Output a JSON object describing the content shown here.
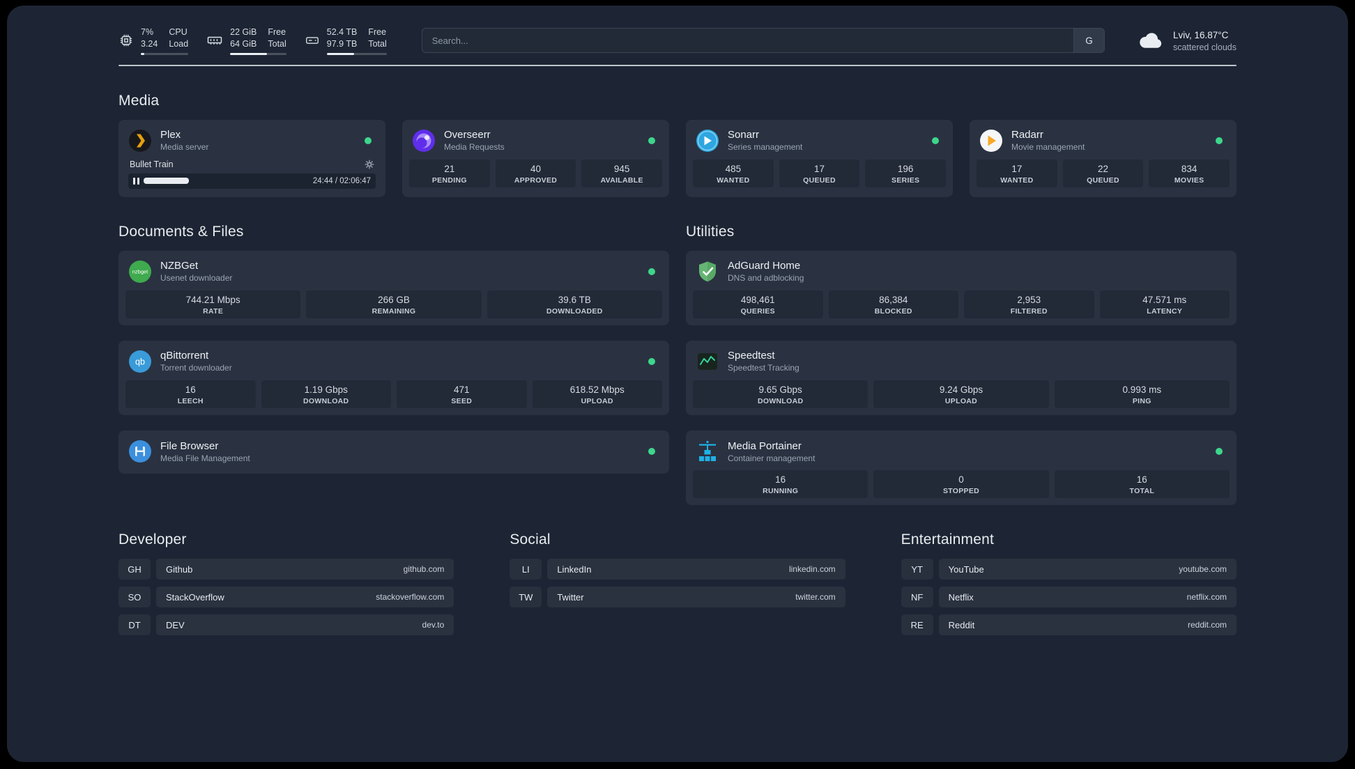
{
  "topbar": {
    "cpu": {
      "percent": "7%",
      "load": "3.24",
      "label1": "CPU",
      "label2": "Load",
      "progress_pct": 7
    },
    "memory": {
      "free": "22 GiB",
      "total": "64 GiB",
      "label1": "Free",
      "label2": "Total",
      "progress_pct": 66
    },
    "disk": {
      "free": "52.4 TB",
      "total": "97.9 TB",
      "label1": "Free",
      "label2": "Total",
      "progress_pct": 46
    },
    "search": {
      "placeholder": "Search...",
      "provider": "G"
    },
    "weather": {
      "location": "Lviv, 16.87°C",
      "condition": "scattered clouds"
    }
  },
  "media": {
    "title": "Media",
    "plex": {
      "name": "Plex",
      "subtitle": "Media server",
      "status": "online",
      "player": {
        "track": "Bullet Train",
        "time": "24:44 / 02:06:47",
        "progress_pct": 19
      }
    },
    "overseerr": {
      "name": "Overseerr",
      "subtitle": "Media Requests",
      "status": "online",
      "stats": [
        {
          "value": "21",
          "label": "PENDING"
        },
        {
          "value": "40",
          "label": "APPROVED"
        },
        {
          "value": "945",
          "label": "AVAILABLE"
        }
      ]
    },
    "sonarr": {
      "name": "Sonarr",
      "subtitle": "Series management",
      "status": "online",
      "stats": [
        {
          "value": "485",
          "label": "WANTED"
        },
        {
          "value": "17",
          "label": "QUEUED"
        },
        {
          "value": "196",
          "label": "SERIES"
        }
      ]
    },
    "radarr": {
      "name": "Radarr",
      "subtitle": "Movie management",
      "status": "online",
      "stats": [
        {
          "value": "17",
          "label": "WANTED"
        },
        {
          "value": "22",
          "label": "QUEUED"
        },
        {
          "value": "834",
          "label": "MOVIES"
        }
      ]
    }
  },
  "documents": {
    "title": "Documents & Files",
    "nzbget": {
      "name": "NZBGet",
      "subtitle": "Usenet downloader",
      "status": "online",
      "stats": [
        {
          "value": "744.21 Mbps",
          "label": "RATE"
        },
        {
          "value": "266 GB",
          "label": "REMAINING"
        },
        {
          "value": "39.6 TB",
          "label": "DOWNLOADED"
        }
      ]
    },
    "qbittorrent": {
      "name": "qBittorrent",
      "subtitle": "Torrent downloader",
      "status": "online",
      "stats": [
        {
          "value": "16",
          "label": "LEECH"
        },
        {
          "value": "1.19 Gbps",
          "label": "DOWNLOAD"
        },
        {
          "value": "471",
          "label": "SEED"
        },
        {
          "value": "618.52 Mbps",
          "label": "UPLOAD"
        }
      ]
    },
    "filebrowser": {
      "name": "File Browser",
      "subtitle": "Media File Management",
      "status": "online"
    }
  },
  "utilities": {
    "title": "Utilities",
    "adguard": {
      "name": "AdGuard Home",
      "subtitle": "DNS and adblocking",
      "stats": [
        {
          "value": "498,461",
          "label": "QUERIES"
        },
        {
          "value": "86,384",
          "label": "BLOCKED"
        },
        {
          "value": "2,953",
          "label": "FILTERED"
        },
        {
          "value": "47.571 ms",
          "label": "LATENCY"
        }
      ]
    },
    "speedtest": {
      "name": "Speedtest",
      "subtitle": "Speedtest Tracking",
      "stats": [
        {
          "value": "9.65 Gbps",
          "label": "DOWNLOAD"
        },
        {
          "value": "9.24 Gbps",
          "label": "UPLOAD"
        },
        {
          "value": "0.993 ms",
          "label": "PING"
        }
      ]
    },
    "portainer": {
      "name": "Media Portainer",
      "subtitle": "Container management",
      "status": "online",
      "stats": [
        {
          "value": "16",
          "label": "RUNNING"
        },
        {
          "value": "0",
          "label": "STOPPED"
        },
        {
          "value": "16",
          "label": "TOTAL"
        }
      ]
    }
  },
  "bookmarks": {
    "developer": {
      "title": "Developer",
      "items": [
        {
          "abbr": "GH",
          "name": "Github",
          "domain": "github.com"
        },
        {
          "abbr": "SO",
          "name": "StackOverflow",
          "domain": "stackoverflow.com"
        },
        {
          "abbr": "DT",
          "name": "DEV",
          "domain": "dev.to"
        }
      ]
    },
    "social": {
      "title": "Social",
      "items": [
        {
          "abbr": "LI",
          "name": "LinkedIn",
          "domain": "linkedin.com"
        },
        {
          "abbr": "TW",
          "name": "Twitter",
          "domain": "twitter.com"
        }
      ]
    },
    "entertainment": {
      "title": "Entertainment",
      "items": [
        {
          "abbr": "YT",
          "name": "YouTube",
          "domain": "youtube.com"
        },
        {
          "abbr": "NF",
          "name": "Netflix",
          "domain": "netflix.com"
        },
        {
          "abbr": "RE",
          "name": "Reddit",
          "domain": "reddit.com"
        }
      ]
    }
  },
  "colors": {
    "page_bg": "#1d2534",
    "card_bg": "#2a3241",
    "tile_bg": "#222a38",
    "status_online": "#3dd68c",
    "plex_accent": "#e5a00d",
    "overseerr_accent": "#5f2eea",
    "sonarr_accent": "#2ea6e0",
    "radarr_accent": "#f7a825",
    "nzbget_accent": "#3faa4e",
    "qbittorrent_accent": "#3a9bd9",
    "filebrowser_accent": "#3c8fdd",
    "adguard_accent": "#66b574",
    "speedtest_accent": "#34d399",
    "portainer_accent": "#1fb1e6"
  }
}
